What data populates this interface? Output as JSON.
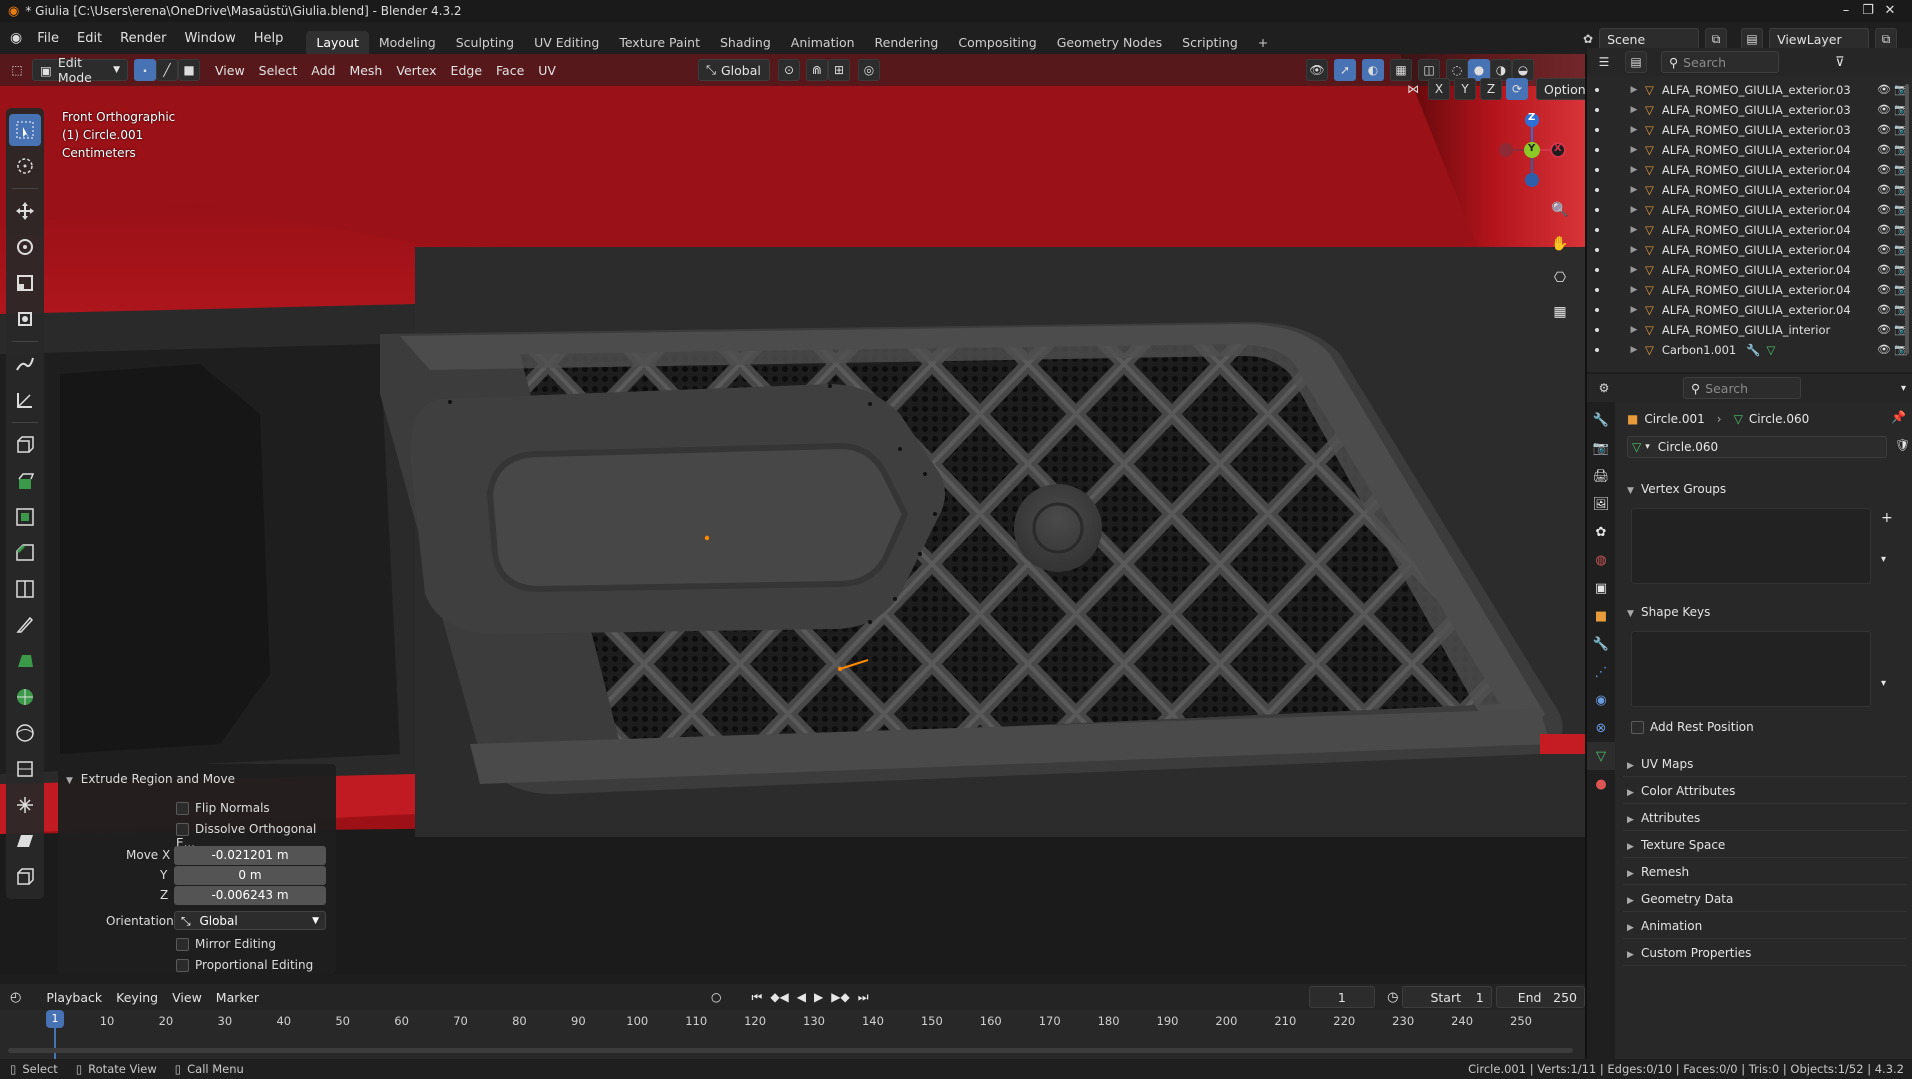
{
  "window": {
    "title": "* Giulia [C:\\Users\\erena\\OneDrive\\Masaüstü\\Giulia.blend] - Blender 4.3.2"
  },
  "menu": [
    "File",
    "Edit",
    "Render",
    "Window",
    "Help"
  ],
  "workspaces": [
    "Layout",
    "Modeling",
    "Sculpting",
    "UV Editing",
    "Texture Paint",
    "Shading",
    "Animation",
    "Rendering",
    "Compositing",
    "Geometry Nodes",
    "Scripting"
  ],
  "active_workspace": "Layout",
  "scene": {
    "label": "Scene",
    "view_layer": "ViewLayer"
  },
  "viewport_header": {
    "mode": "Edit Mode",
    "menus": [
      "View",
      "Select",
      "Add",
      "Mesh",
      "Vertex",
      "Edge",
      "Face",
      "UV"
    ],
    "orientation": "Global",
    "options_label": "Options",
    "axes": [
      "X",
      "Y",
      "Z"
    ]
  },
  "viewport_info": {
    "view": "Front Orthographic",
    "object": "(1) Circle.001",
    "units": "Centimeters"
  },
  "gizmo": {
    "x": "X",
    "y": "Y",
    "z": "Z"
  },
  "operator_panel": {
    "title": "Extrude Region and Move",
    "flip_normals": "Flip Normals",
    "dissolve": "Dissolve Orthogonal E...",
    "move_x_label": "Move X",
    "move_x": "-0.021201 m",
    "y_label": "Y",
    "move_y": "0 m",
    "z_label": "Z",
    "move_z": "-0.006243 m",
    "orientation_label": "Orientation",
    "orientation": "Global",
    "mirror_editing": "Mirror Editing",
    "proportional_editing": "Proportional Editing"
  },
  "timeline": {
    "menus": [
      "Playback",
      "Keying",
      "View",
      "Marker"
    ],
    "current_frame": "1",
    "start_label": "Start",
    "start": "1",
    "end_label": "End",
    "end": "250",
    "ticks": [
      "1",
      "10",
      "20",
      "30",
      "40",
      "50",
      "60",
      "70",
      "80",
      "90",
      "100",
      "110",
      "120",
      "130",
      "140",
      "150",
      "160",
      "170",
      "180",
      "190",
      "200",
      "210",
      "220",
      "230",
      "240",
      "250"
    ]
  },
  "status": {
    "select": "Select",
    "rotate": "Rotate View",
    "call_menu": "Call Menu",
    "stats": "Circle.001 | Verts:1/11 | Edges:0/10 | Faces:0/0 | Tris:0 | Objects:1/52 | 4.3.2"
  },
  "outliner": {
    "search_placeholder": "Search",
    "items": [
      "ALFA_ROMEO_GIULIA_exterior.03",
      "ALFA_ROMEO_GIULIA_exterior.03",
      "ALFA_ROMEO_GIULIA_exterior.03",
      "ALFA_ROMEO_GIULIA_exterior.04",
      "ALFA_ROMEO_GIULIA_exterior.04",
      "ALFA_ROMEO_GIULIA_exterior.04",
      "ALFA_ROMEO_GIULIA_exterior.04",
      "ALFA_ROMEO_GIULIA_exterior.04",
      "ALFA_ROMEO_GIULIA_exterior.04",
      "ALFA_ROMEO_GIULIA_exterior.04",
      "ALFA_ROMEO_GIULIA_exterior.04",
      "ALFA_ROMEO_GIULIA_exterior.04",
      "ALFA_ROMEO_GIULIA_interior",
      "Carbon1.001"
    ]
  },
  "properties": {
    "search_placeholder": "Search",
    "breadcrumb_object": "Circle.001",
    "breadcrumb_mesh": "Circle.060",
    "datablock": "Circle.060",
    "vertex_groups": "Vertex Groups",
    "shape_keys": "Shape Keys",
    "add_rest_position": "Add Rest Position",
    "sections": [
      "UV Maps",
      "Color Attributes",
      "Attributes",
      "Texture Space",
      "Remesh",
      "Geometry Data",
      "Animation",
      "Custom Properties"
    ]
  },
  "colors": {
    "accent": "#4772b3",
    "car_red": "#b01018",
    "grille": "#3a3a3a",
    "vertex": "#ff8a00"
  }
}
